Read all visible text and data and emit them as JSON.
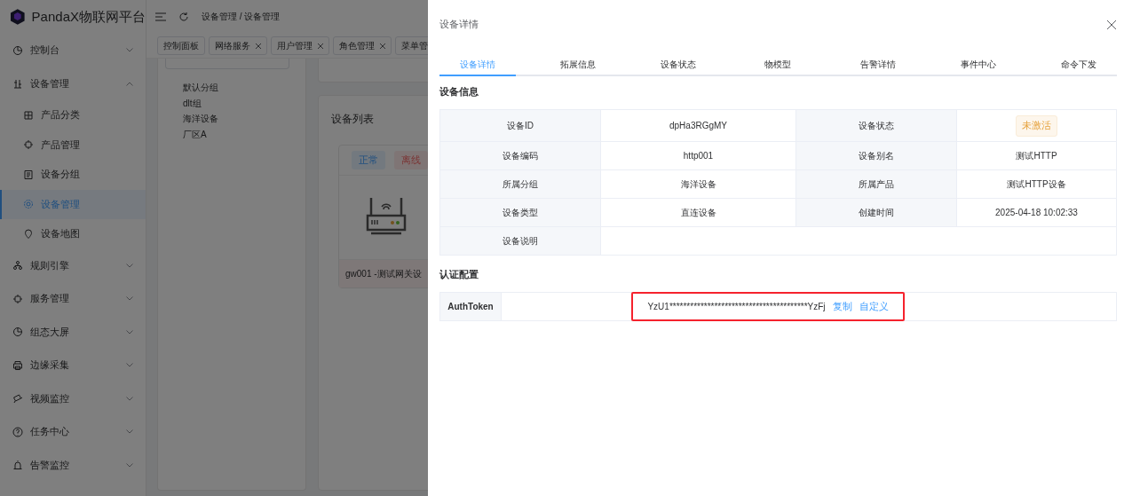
{
  "app": {
    "title": "PandaX物联网平台",
    "breadcrumb": "设备管理 / 设备管理",
    "sidebar": {
      "items": [
        {
          "label": "控制台",
          "expanded": false,
          "selected": false
        },
        {
          "label": "设备管理",
          "expanded": true,
          "selected": false,
          "children": [
            {
              "label": "产品分类",
              "selected": false
            },
            {
              "label": "产品管理",
              "selected": false
            },
            {
              "label": "设备分组",
              "selected": false
            },
            {
              "label": "设备管理",
              "selected": true
            },
            {
              "label": "设备地图",
              "selected": false
            }
          ]
        },
        {
          "label": "规则引擎",
          "expanded": false,
          "selected": false
        },
        {
          "label": "服务管理",
          "expanded": false,
          "selected": false
        },
        {
          "label": "组态大屏",
          "expanded": false,
          "selected": false
        },
        {
          "label": "边缘采集",
          "expanded": false,
          "selected": false
        },
        {
          "label": "视频监控",
          "expanded": false,
          "selected": false
        },
        {
          "label": "任务中心",
          "expanded": false,
          "selected": false
        },
        {
          "label": "告警监控",
          "expanded": false,
          "selected": false
        }
      ]
    },
    "open_tabs": [
      {
        "label": "控制面板",
        "closable": false
      },
      {
        "label": "网络服务",
        "closable": true
      },
      {
        "label": "用户管理",
        "closable": true
      },
      {
        "label": "角色管理",
        "closable": true
      },
      {
        "label": "菜单管",
        "closable": false
      }
    ],
    "group_tree": [
      "默认分组",
      "dlt组",
      "海洋设备",
      "厂区A"
    ],
    "device_list": {
      "title": "设备列表",
      "status_tags": [
        {
          "label": "正常",
          "kind": "normal"
        },
        {
          "label": "离线",
          "kind": "offline"
        }
      ],
      "card_label": "gw001 -测试网关设"
    }
  },
  "drawer": {
    "title": "设备详情",
    "tabs": [
      {
        "label": "设备详情",
        "selected": true
      },
      {
        "label": "拓展信息",
        "selected": false
      },
      {
        "label": "设备状态",
        "selected": false
      },
      {
        "label": "物模型",
        "selected": false
      },
      {
        "label": "告警详情",
        "selected": false
      },
      {
        "label": "事件中心",
        "selected": false
      },
      {
        "label": "命令下发",
        "selected": false
      }
    ],
    "info_title": "设备信息",
    "info_rows": [
      [
        {
          "label": "设备ID",
          "value": "dpHa3RGgMY",
          "kind": "text"
        },
        {
          "label": "设备状态",
          "value": "未激活",
          "kind": "tag"
        }
      ],
      [
        {
          "label": "设备编码",
          "value": "http001",
          "kind": "text"
        },
        {
          "label": "设备别名",
          "value": "测试HTTP",
          "kind": "text"
        }
      ],
      [
        {
          "label": "所属分组",
          "value": "海洋设备",
          "kind": "text"
        },
        {
          "label": "所属产品",
          "value": "测试HTTP设备",
          "kind": "text"
        }
      ],
      [
        {
          "label": "设备类型",
          "value": "直连设备",
          "kind": "text"
        },
        {
          "label": "创建时间",
          "value": "2025-04-18 10:02:33",
          "kind": "text"
        }
      ],
      [
        {
          "label": "设备说明",
          "kind": "text"
        }
      ]
    ],
    "auth_title": "认证配置",
    "auth": {
      "label": "AuthToken",
      "token": "YzU1****************************************YzFj",
      "links": [
        "复制",
        "自定义"
      ],
      "highlighted": true
    }
  }
}
